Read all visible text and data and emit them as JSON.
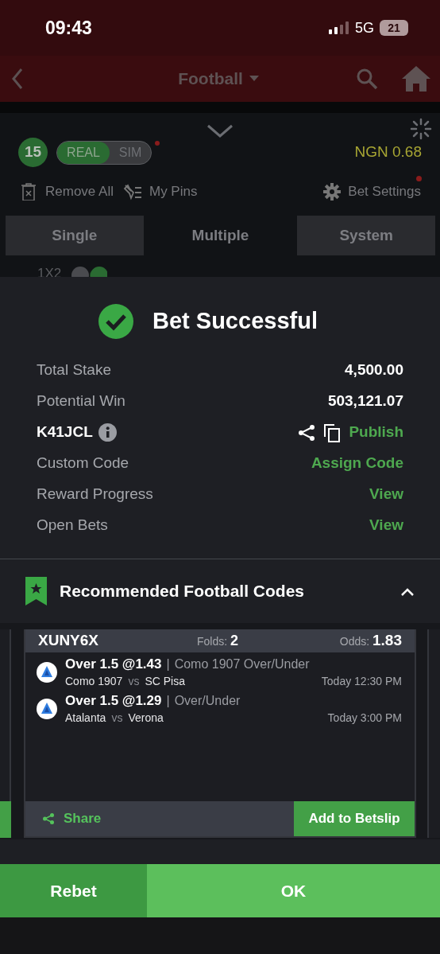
{
  "status_bar": {
    "time": "09:43",
    "network": "5G",
    "battery": "21"
  },
  "nav": {
    "title": "Football"
  },
  "betslip": {
    "count": "15",
    "modes": [
      {
        "label": "REAL",
        "selected": true
      },
      {
        "label": "SIM",
        "selected": false
      }
    ],
    "balance": "NGN 0.68",
    "actions": [
      {
        "kind": "remove",
        "label": "Remove All"
      },
      {
        "kind": "pins",
        "label": "My Pins"
      },
      {
        "kind": "settings",
        "label": "Bet Settings"
      }
    ],
    "tabs": [
      {
        "label": "Single",
        "selected": false
      },
      {
        "label": "Multiple",
        "selected": true
      },
      {
        "label": "System",
        "selected": false
      }
    ],
    "market": "1X2"
  },
  "result": {
    "title": "Bet Successful",
    "rows": [
      {
        "kind": "plain",
        "label": "Total Stake",
        "value": "4,500.00"
      },
      {
        "kind": "plain",
        "label": "Potential Win",
        "value": "503,121.07"
      },
      {
        "kind": "code",
        "label": "K41JCL",
        "value": "Publish"
      },
      {
        "kind": "link",
        "label": "Custom Code",
        "value": "Assign Code"
      },
      {
        "kind": "link",
        "label": "Reward Progress",
        "value": "View"
      },
      {
        "kind": "link",
        "label": "Open Bets",
        "value": "View"
      }
    ]
  },
  "recommended": {
    "title": "Recommended Football Codes",
    "expanded": true,
    "card": {
      "code": "XUNY6X",
      "folds_label": "Folds:",
      "folds": "2",
      "odds_label": "Odds:",
      "odds": "1.83",
      "selections": [
        {
          "pick": "Over 1.5 @1.43",
          "separator": "|",
          "market": "Como 1907 Over/Under",
          "home": "Como 1907",
          "vs": "vs",
          "away": "SC Pisa",
          "time": "Today 12:30 PM"
        },
        {
          "pick": "Over 1.5 @1.29",
          "separator": "|",
          "market": "Over/Under",
          "home": "Atalanta",
          "vs": "vs",
          "away": "Verona",
          "time": "Today 3:00 PM"
        }
      ],
      "share": "Share",
      "add": "Add to Betslip"
    }
  },
  "buttons": [
    {
      "kind": "rebet",
      "label": "Rebet"
    },
    {
      "kind": "ok",
      "label": "OK"
    }
  ]
}
